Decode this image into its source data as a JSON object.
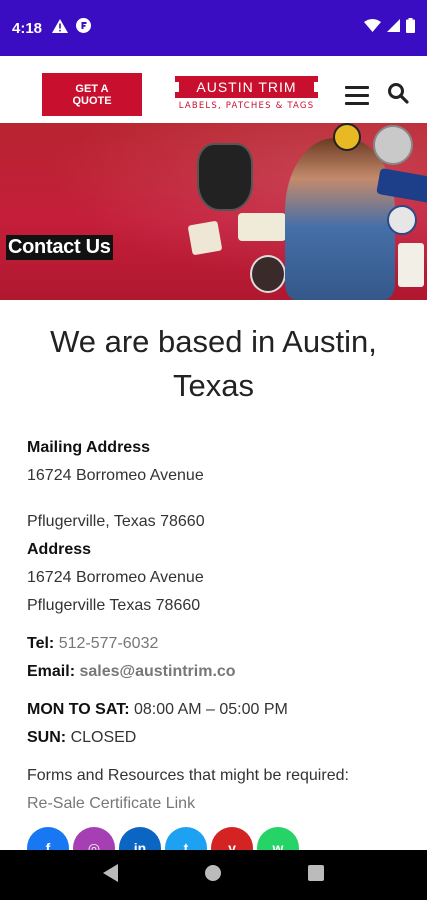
{
  "status_bar": {
    "time": "4:18"
  },
  "header": {
    "quote_button": "GET A QUOTE",
    "logo_title": "AUSTIN TRIM",
    "logo_subtitle": "LABELS, PATCHES & TAGS"
  },
  "hero": {
    "title": "Contact Us"
  },
  "main": {
    "heading": "We are based in Austin, Texas",
    "mailing_label": "Mailing Address",
    "mailing_line1": "16724 Borromeo Avenue",
    "mailing_line2": "Pflugerville, Texas 78660",
    "address_label": "Address",
    "address_line1": "16724 Borromeo Avenue",
    "address_line2": "Pflugerville Texas 78660",
    "tel_label": "Tel:",
    "tel_value": "512-577-6032",
    "email_label": "Email:",
    "email_value": "sales@austintrim.co",
    "hours1_label": "MON TO SAT:",
    "hours1_value": "08:00 AM – 05:00 PM",
    "hours2_label": "SUN:",
    "hours2_value": "CLOSED",
    "forms_text": "Forms and Resources that might be required:",
    "resale_link": "Re-Sale Certificate Link"
  },
  "social": [
    {
      "name": "facebook",
      "glyph": "f",
      "color": "#1877f2"
    },
    {
      "name": "instagram",
      "glyph": "◎",
      "color": "#a63fb3"
    },
    {
      "name": "linkedin",
      "glyph": "in",
      "color": "#0a66c2"
    },
    {
      "name": "twitter",
      "glyph": "t",
      "color": "#1da1f2"
    },
    {
      "name": "yelp",
      "glyph": "y",
      "color": "#d32323"
    },
    {
      "name": "whatsapp",
      "glyph": "w",
      "color": "#25d366"
    }
  ],
  "colors": {
    "status_bar": "#3a0cc2",
    "brand_red": "#c8102e"
  }
}
